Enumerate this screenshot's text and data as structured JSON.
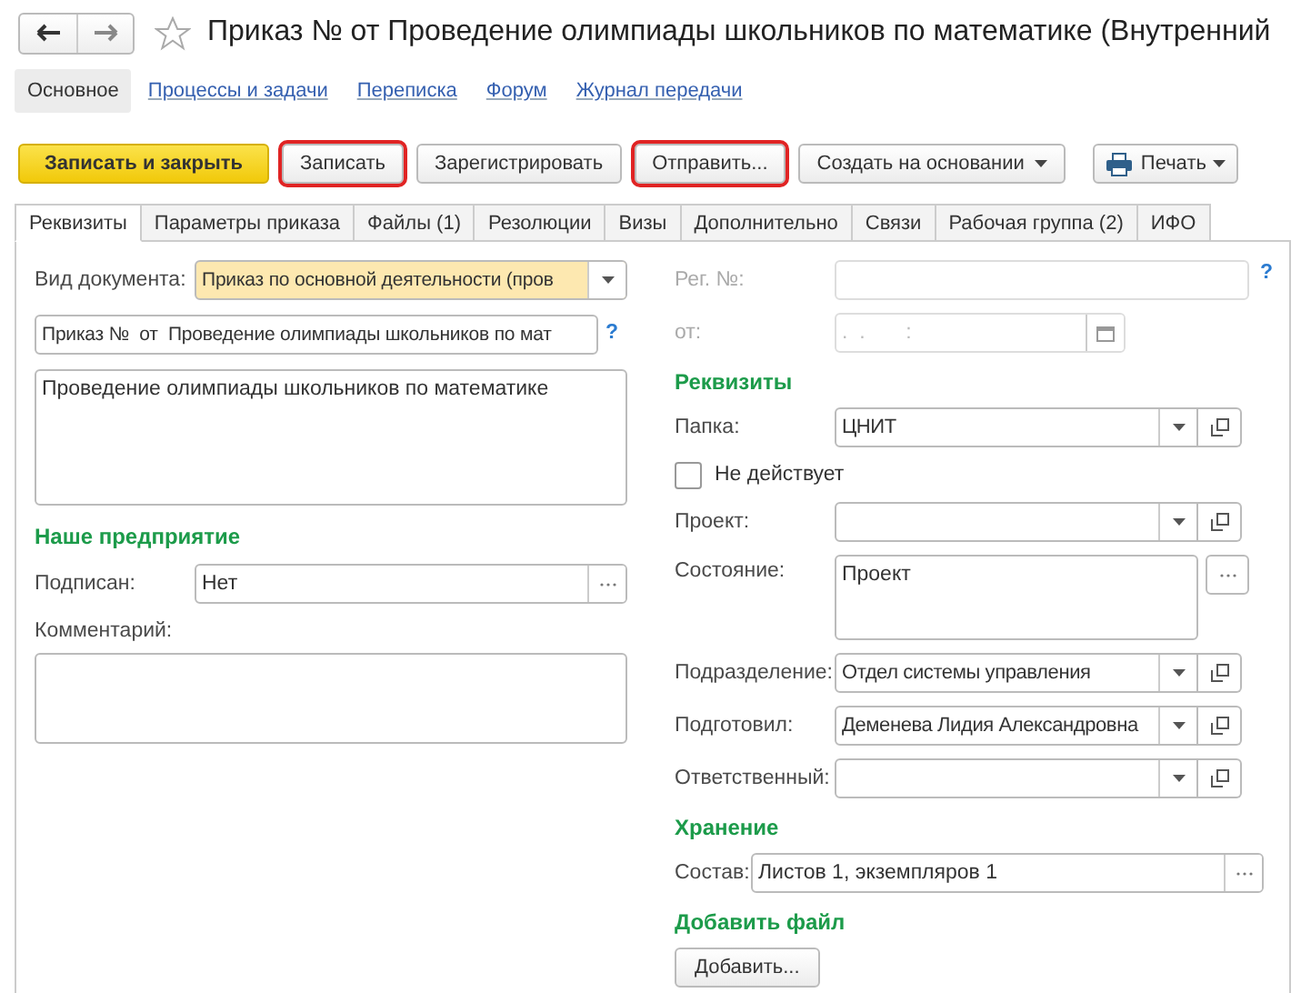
{
  "window": {
    "title": "Приказ №  от  Проведение олимпиады школьников по математике (Внутренний"
  },
  "nav": [
    {
      "label": "Основное",
      "selected": true
    },
    {
      "label": "Процессы и задачи",
      "selected": false
    },
    {
      "label": "Переписка",
      "selected": false
    },
    {
      "label": "Форум",
      "selected": false
    },
    {
      "label": "Журнал передачи",
      "selected": false
    }
  ],
  "toolbar": [
    {
      "label": "Записать и закрыть",
      "kind": "primary",
      "highlighted": false
    },
    {
      "label": "Записать",
      "kind": "normal",
      "highlighted": true
    },
    {
      "label": "Зарегистрировать",
      "kind": "normal",
      "highlighted": false
    },
    {
      "label": "Отправить...",
      "kind": "normal",
      "highlighted": true
    },
    {
      "label": "Создать на основании",
      "kind": "menu",
      "highlighted": false
    },
    {
      "label": "Печать",
      "kind": "print",
      "highlighted": false
    }
  ],
  "tabs": [
    {
      "label": "Реквизиты",
      "selected": true
    },
    {
      "label": "Параметры приказа",
      "selected": false
    },
    {
      "label": "Файлы (1)",
      "selected": false
    },
    {
      "label": "Резолюции",
      "selected": false
    },
    {
      "label": "Визы",
      "selected": false
    },
    {
      "label": "Дополнительно",
      "selected": false
    },
    {
      "label": "Связи",
      "selected": false
    },
    {
      "label": "Рабочая группа (2)",
      "selected": false
    },
    {
      "label": "ИФО",
      "selected": false
    }
  ],
  "left": [
    {
      "kind": "dropdown",
      "label": "Вид документа:",
      "value": "Приказ по основной деятельности (пров",
      "highlighted": true,
      "disabled": false
    },
    {
      "kind": "text",
      "value": "Приказ №  от  Проведение олимпиады школьников по мат",
      "highlighted": false,
      "disabled": false,
      "help": "?"
    },
    {
      "kind": "memo",
      "value": "Проведение олимпиады школьников по математике",
      "highlighted": false,
      "disabled": false
    },
    {
      "kind": "heading",
      "label": "Наше предприятие"
    },
    {
      "kind": "pick",
      "label": "Подписан:",
      "value": "Нет",
      "highlighted": false,
      "disabled": false
    },
    {
      "kind": "memo",
      "label": "Комментарий:",
      "highlighted": false,
      "disabled": false
    }
  ],
  "right": [
    {
      "kind": "text",
      "label": "Рег. №:",
      "highlighted": false,
      "disabled": true,
      "help": "?"
    },
    {
      "kind": "date",
      "label": "от:",
      "placeholder": ".  .       :",
      "highlighted": false,
      "disabled": true
    },
    {
      "kind": "heading",
      "label": "Реквизиты"
    },
    {
      "kind": "select",
      "label": "Папка:",
      "value": "ЦНИТ",
      "highlighted": false,
      "disabled": false
    },
    {
      "kind": "checkbox",
      "label": "Не действует",
      "checked": false
    },
    {
      "kind": "select",
      "label": "Проект:",
      "highlighted": false,
      "disabled": false
    },
    {
      "kind": "memo_pick",
      "label": "Состояние:",
      "value": "Проект",
      "highlighted": false,
      "disabled": false
    },
    {
      "kind": "select",
      "label": "Подразделение:",
      "value": "Отдел системы управления",
      "highlighted": false,
      "disabled": false
    },
    {
      "kind": "select",
      "label": "Подготовил:",
      "value": "Деменева Лидия Александровна",
      "highlighted": false,
      "disabled": false
    },
    {
      "kind": "select",
      "label": "Ответственный:",
      "highlighted": false,
      "disabled": false
    },
    {
      "kind": "heading",
      "label": "Хранение"
    },
    {
      "kind": "pick_short",
      "label": "Состав:",
      "value": "Листов 1, экземпляров 1",
      "highlighted": false,
      "disabled": false
    },
    {
      "kind": "heading",
      "label": "Добавить файл"
    },
    {
      "kind": "button",
      "label": "Добавить..."
    }
  ]
}
